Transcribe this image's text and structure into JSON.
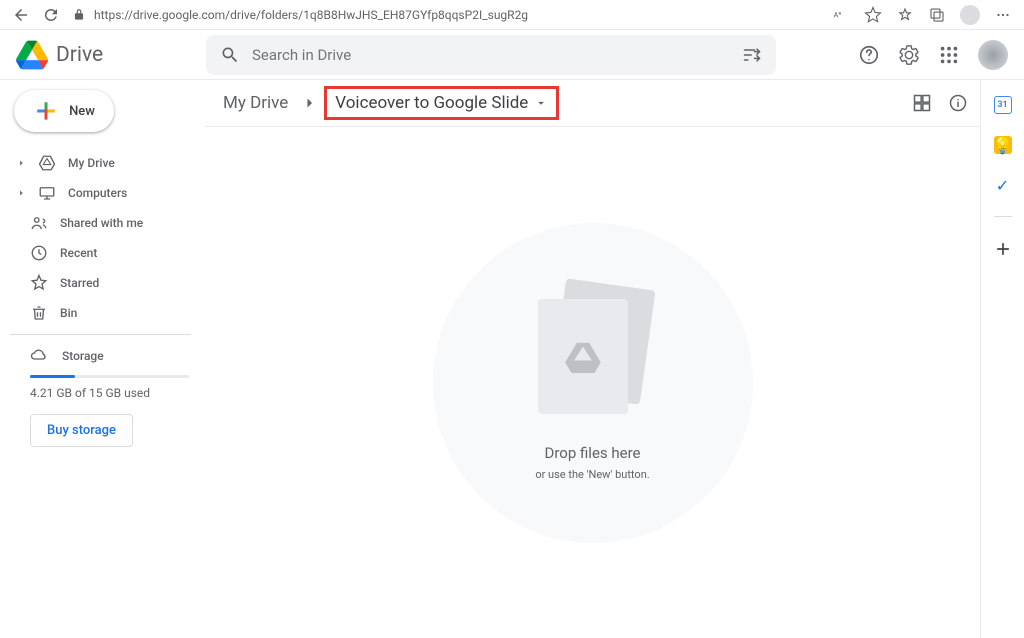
{
  "browser": {
    "url": "https://drive.google.com/drive/folders/1q8B8HwJHS_EH87GYfp8qqsP2I_sugR2g"
  },
  "header": {
    "product_name": "Drive",
    "search_placeholder": "Search in Drive"
  },
  "sidebar": {
    "new_label": "New",
    "items": [
      {
        "label": "My Drive",
        "expandable": true,
        "icon": "drive"
      },
      {
        "label": "Computers",
        "expandable": true,
        "icon": "computers"
      },
      {
        "label": "Shared with me",
        "expandable": false,
        "icon": "shared"
      },
      {
        "label": "Recent",
        "expandable": false,
        "icon": "recent"
      },
      {
        "label": "Starred",
        "expandable": false,
        "icon": "star"
      },
      {
        "label": "Bin",
        "expandable": false,
        "icon": "bin"
      }
    ],
    "storage_label": "Storage",
    "storage_used": "4.21 GB of 15 GB used",
    "buy_storage": "Buy storage"
  },
  "breadcrumb": {
    "root": "My Drive",
    "current": "Voiceover to Google Slide"
  },
  "empty": {
    "title": "Drop files here",
    "subtitle": "or use the 'New' button."
  }
}
